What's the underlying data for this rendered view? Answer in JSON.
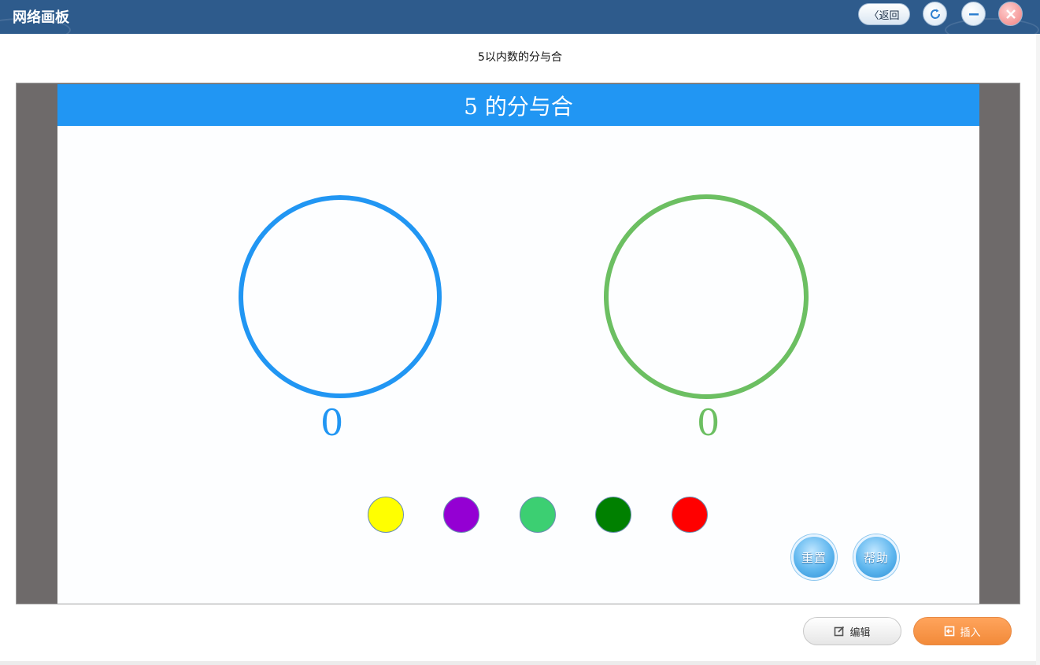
{
  "window": {
    "title": "网络画板",
    "back_label": "〈返回",
    "refresh_icon": "refresh-icon",
    "minimize_icon": "minimize-icon",
    "close_icon": "close-icon"
  },
  "document": {
    "title": "5以内数的分与合"
  },
  "stage": {
    "header": "5 的分与合",
    "left_count": "0",
    "right_count": "0",
    "left_ring_color": "#2196f3",
    "right_ring_color": "#6cbf62",
    "dots": [
      "#ffff00",
      "#9400d3",
      "#3ccf72",
      "#008000",
      "#ff0000"
    ],
    "reset_label": "重置",
    "help_label": "帮助"
  },
  "footer": {
    "edit_label": "编辑",
    "insert_label": "插入"
  }
}
